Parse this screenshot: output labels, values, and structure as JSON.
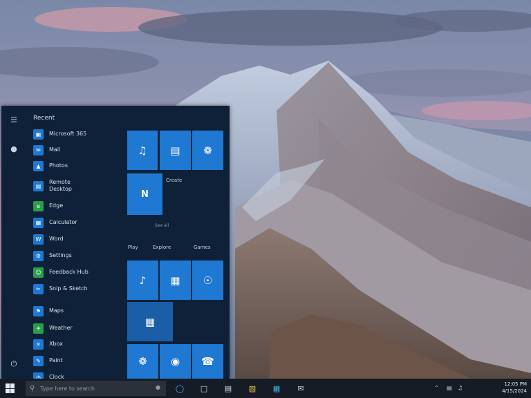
{
  "colors": {
    "start_menu_bg": "#0f2138",
    "tile_blue": "#1f78d1",
    "tile_dark_blue": "#1a5ea8",
    "taskbar_bg": "#161c25"
  },
  "start_menu": {
    "header": "Recent",
    "rail_icons": [
      "hamburger-menu-icon",
      "user-icon",
      "power-icon"
    ],
    "apps": [
      {
        "label": "Microsoft 365",
        "icon": "office-icon",
        "color": "#1e78d4"
      },
      {
        "label": "Mail",
        "icon": "mail-icon",
        "color": "#1e78d4"
      },
      {
        "label": "Photos",
        "icon": "photos-icon",
        "color": "#1e78d4"
      },
      {
        "label": "Remote\nDesktop",
        "icon": "remote-desktop-icon",
        "color": "#1e78d4"
      },
      {
        "label": "Edge",
        "icon": "edge-icon",
        "color": "#2a9d4a"
      },
      {
        "label": "Calculator",
        "icon": "calculator-icon",
        "color": "#1e78d4"
      },
      {
        "label": "Word",
        "icon": "word-icon",
        "color": "#1e78d4"
      },
      {
        "label": "Settings",
        "icon": "settings-icon",
        "color": "#1e78d4"
      },
      {
        "label": "Feedback Hub",
        "icon": "feedback-icon",
        "color": "#2a9d4a"
      },
      {
        "label": "Snip & Sketch",
        "icon": "snip-icon",
        "color": "#1e78d4"
      },
      {
        "label": "Maps",
        "icon": "maps-icon",
        "color": "#1e78d4"
      },
      {
        "label": "Weather",
        "icon": "weather-icon",
        "color": "#2a9d4a"
      },
      {
        "label": "Xbox",
        "icon": "xbox-icon",
        "color": "#1e78d4"
      },
      {
        "label": "Paint",
        "icon": "paint-icon",
        "color": "#1e78d4"
      },
      {
        "label": "Clock",
        "icon": "clock-icon",
        "color": "#1e78d4"
      }
    ],
    "tiles": {
      "group1_label": "Create",
      "group2_label": "Play",
      "group3_label": "Explore",
      "group4_label": "Games",
      "more_hint": "See all"
    }
  },
  "taskbar": {
    "search_placeholder": "Type here to search",
    "clock_time": "12:05 PM",
    "clock_date": "4/15/2024",
    "tray_icons": [
      "chevron-up-icon",
      "network-icon",
      "volume-icon"
    ]
  }
}
